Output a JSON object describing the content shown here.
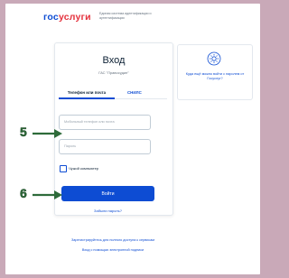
{
  "header": {
    "logo_part1": "гос",
    "logo_part2": "услуги",
    "tagline": "Единая система идентификации и аутентификации"
  },
  "login": {
    "title": "Вход",
    "subtitle": "ГАС \"Правосудие\"",
    "tabs": [
      {
        "label": "Телефон или почта",
        "active": true
      },
      {
        "label": "СНИЛС",
        "active": false
      }
    ],
    "phone_placeholder": "Мобильный телефон или почта",
    "password_placeholder": "Пароль",
    "remember_label": "Чужой компьютер",
    "submit_label": "Войти",
    "forgot_label": "Забыли пароль?"
  },
  "side_panel": {
    "text": "Куда ещё можно войти с паролем от Госуслуг?"
  },
  "footer": {
    "register_text": "Зарегистрируйтесь для полного доступа к сервисам",
    "esign_text": "Вход с помощью электронной подписи"
  },
  "annotations": {
    "step_field": "5",
    "step_button": "6"
  },
  "colors": {
    "brand_blue": "#0d4cd3",
    "brand_red": "#e4313d",
    "annotation_green": "#2e6b3a"
  }
}
